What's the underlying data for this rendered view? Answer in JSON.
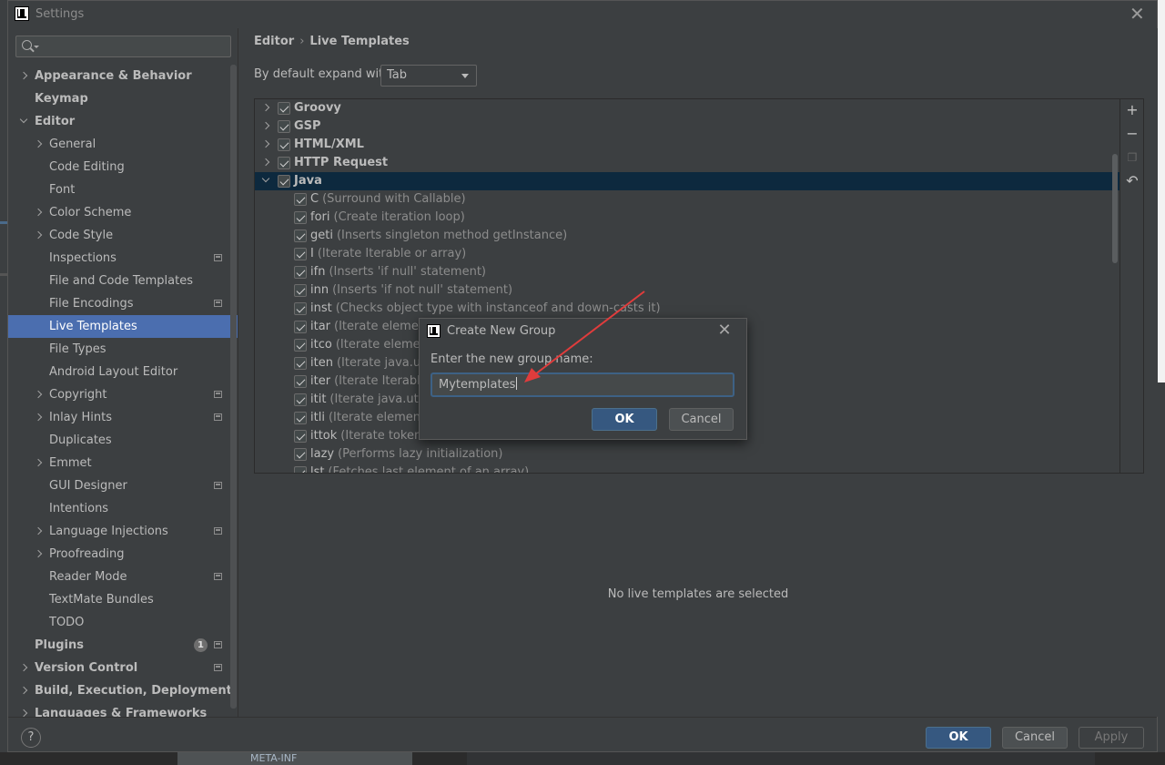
{
  "window": {
    "title": "Settings"
  },
  "sidebar": {
    "search_placeholder": "",
    "items": [
      {
        "label": "Appearance & Behavior",
        "bold": true,
        "indent": 0,
        "arrow": "right"
      },
      {
        "label": "Keymap",
        "bold": true,
        "indent": 0,
        "arrow": "none"
      },
      {
        "label": "Editor",
        "bold": true,
        "indent": 0,
        "arrow": "down"
      },
      {
        "label": "General",
        "bold": false,
        "indent": 1,
        "arrow": "right"
      },
      {
        "label": "Code Editing",
        "bold": false,
        "indent": 1,
        "arrow": "none"
      },
      {
        "label": "Font",
        "bold": false,
        "indent": 1,
        "arrow": "none"
      },
      {
        "label": "Color Scheme",
        "bold": false,
        "indent": 1,
        "arrow": "right"
      },
      {
        "label": "Code Style",
        "bold": false,
        "indent": 1,
        "arrow": "right"
      },
      {
        "label": "Inspections",
        "bold": false,
        "indent": 1,
        "arrow": "none",
        "project_icon": true
      },
      {
        "label": "File and Code Templates",
        "bold": false,
        "indent": 1,
        "arrow": "none"
      },
      {
        "label": "File Encodings",
        "bold": false,
        "indent": 1,
        "arrow": "none",
        "project_icon": true
      },
      {
        "label": "Live Templates",
        "bold": false,
        "indent": 1,
        "arrow": "none",
        "selected": true
      },
      {
        "label": "File Types",
        "bold": false,
        "indent": 1,
        "arrow": "none"
      },
      {
        "label": "Android Layout Editor",
        "bold": false,
        "indent": 1,
        "arrow": "none"
      },
      {
        "label": "Copyright",
        "bold": false,
        "indent": 1,
        "arrow": "right",
        "project_icon": true
      },
      {
        "label": "Inlay Hints",
        "bold": false,
        "indent": 1,
        "arrow": "right",
        "project_icon": true
      },
      {
        "label": "Duplicates",
        "bold": false,
        "indent": 1,
        "arrow": "none"
      },
      {
        "label": "Emmet",
        "bold": false,
        "indent": 1,
        "arrow": "right"
      },
      {
        "label": "GUI Designer",
        "bold": false,
        "indent": 1,
        "arrow": "none",
        "project_icon": true
      },
      {
        "label": "Intentions",
        "bold": false,
        "indent": 1,
        "arrow": "none"
      },
      {
        "label": "Language Injections",
        "bold": false,
        "indent": 1,
        "arrow": "right",
        "project_icon": true
      },
      {
        "label": "Proofreading",
        "bold": false,
        "indent": 1,
        "arrow": "right"
      },
      {
        "label": "Reader Mode",
        "bold": false,
        "indent": 1,
        "arrow": "none",
        "project_icon": true
      },
      {
        "label": "TextMate Bundles",
        "bold": false,
        "indent": 1,
        "arrow": "none"
      },
      {
        "label": "TODO",
        "bold": false,
        "indent": 1,
        "arrow": "none"
      },
      {
        "label": "Plugins",
        "bold": true,
        "indent": 0,
        "arrow": "none",
        "badge": "1",
        "project_icon": true
      },
      {
        "label": "Version Control",
        "bold": true,
        "indent": 0,
        "arrow": "right",
        "project_icon": true
      },
      {
        "label": "Build, Execution, Deployment",
        "bold": true,
        "indent": 0,
        "arrow": "right"
      },
      {
        "label": "Languages & Frameworks",
        "bold": true,
        "indent": 0,
        "arrow": "right"
      }
    ]
  },
  "breadcrumb": {
    "parent": "Editor",
    "separator": "›",
    "current": "Live Templates"
  },
  "expand": {
    "label": "By default expand with",
    "value": "Tab"
  },
  "templates": {
    "groups_before": [
      {
        "name": "Groovy",
        "checked": true
      },
      {
        "name": "GSP",
        "checked": true
      },
      {
        "name": "HTML/XML",
        "checked": true
      },
      {
        "name": "HTTP Request",
        "checked": true
      }
    ],
    "expanded_group": {
      "name": "Java",
      "checked": true
    },
    "items": [
      {
        "abbr": "C",
        "desc": "(Surround with Callable)"
      },
      {
        "abbr": "fori",
        "desc": "(Create iteration loop)"
      },
      {
        "abbr": "geti",
        "desc": "(Inserts singleton method getInstance)"
      },
      {
        "abbr": "I",
        "desc": "(Iterate Iterable or array)"
      },
      {
        "abbr": "ifn",
        "desc": "(Inserts 'if null' statement)"
      },
      {
        "abbr": "inn",
        "desc": "(Inserts 'if not null' statement)"
      },
      {
        "abbr": "inst",
        "desc": "(Checks object type with instanceof and down-casts it)"
      },
      {
        "abbr": "itar",
        "desc": "(Iterate elements"
      },
      {
        "abbr": "itco",
        "desc": "(Iterate element"
      },
      {
        "abbr": "iten",
        "desc": "(Iterate java.util.E"
      },
      {
        "abbr": "iter",
        "desc": "(Iterate Iterable"
      },
      {
        "abbr": "itit",
        "desc": "(Iterate java.util.It"
      },
      {
        "abbr": "itli",
        "desc": "(Iterate elements"
      },
      {
        "abbr": "ittok",
        "desc": "(Iterate tokens"
      },
      {
        "abbr": "lazy",
        "desc": "(Performs lazy initialization)"
      },
      {
        "abbr": "lst",
        "desc": "(Fetches last element of an array)"
      }
    ],
    "toolbar": [
      "plus-icon",
      "minus-icon",
      "copy-icon",
      "revert-icon"
    ],
    "empty_message": "No live templates are selected"
  },
  "footer": {
    "ok": "OK",
    "cancel": "Cancel",
    "apply": "Apply",
    "help": "?"
  },
  "dialog": {
    "title": "Create New Group",
    "prompt": "Enter the new group name:",
    "value": "Mytemplates",
    "ok": "OK",
    "cancel": "Cancel"
  },
  "colors": {
    "background": "#3c3f41",
    "selection": "#4b6eaf",
    "row_selection": "#0d293e",
    "primary_button": "#365880",
    "annotation": "#e03c3c"
  },
  "background_fragment": "META-INF"
}
